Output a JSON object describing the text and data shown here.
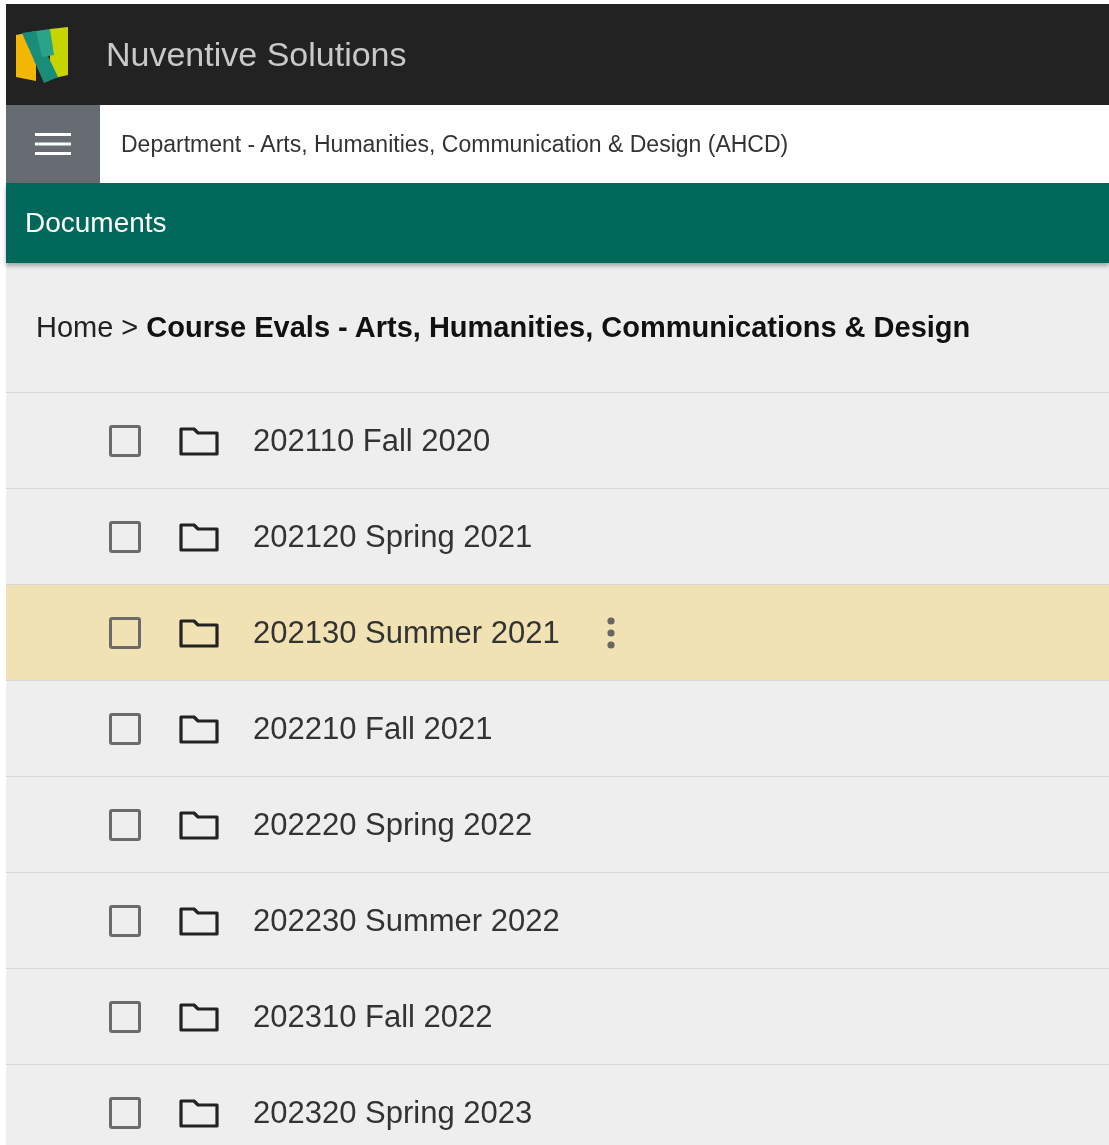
{
  "app": {
    "title": "Nuventive Solutions"
  },
  "context_bar": {
    "label": "Department - Arts, Humanities, Communication & Design (AHCD)"
  },
  "section": {
    "title": "Documents"
  },
  "breadcrumb": [
    {
      "label": "Home",
      "current": false
    },
    {
      "label": "Course Evals - Arts, Humanities, Communications & Design",
      "current": true
    }
  ],
  "breadcrumb_separator": ">",
  "folders": [
    {
      "name": "202110 Fall 2020",
      "checked": false,
      "hovered": false
    },
    {
      "name": "202120 Spring 2021",
      "checked": false,
      "hovered": false
    },
    {
      "name": "202130 Summer 2021",
      "checked": false,
      "hovered": true
    },
    {
      "name": "202210 Fall 2021",
      "checked": false,
      "hovered": false
    },
    {
      "name": "202220 Spring 2022",
      "checked": false,
      "hovered": false
    },
    {
      "name": "202230 Summer 2022",
      "checked": false,
      "hovered": false
    },
    {
      "name": "202310 Fall 2022",
      "checked": false,
      "hovered": false
    },
    {
      "name": "202320 Spring 2023",
      "checked": false,
      "hovered": false
    }
  ]
}
